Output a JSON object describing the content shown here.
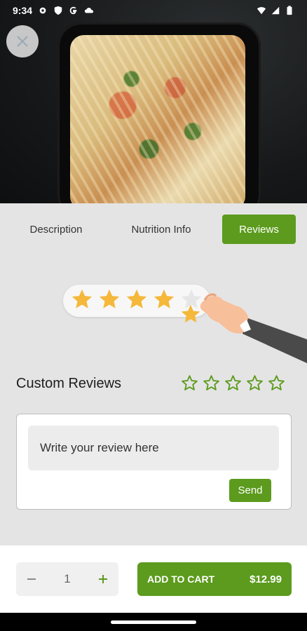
{
  "status": {
    "time": "9:34",
    "left_icons": [
      "gear-icon",
      "shield-icon",
      "google-icon",
      "cloud-icon"
    ],
    "right_icons": [
      "wifi-icon",
      "signal-icon",
      "battery-icon"
    ]
  },
  "hero": {
    "close_icon": "close-icon"
  },
  "tabs": [
    {
      "label": "Description",
      "active": false
    },
    {
      "label": "Nutrition Info",
      "active": false
    },
    {
      "label": "Reviews",
      "active": true
    }
  ],
  "reviews": {
    "title": "Custom Reviews",
    "star_rating_value": 0,
    "star_count": 5,
    "input_placeholder": "Write your review here",
    "input_value": "",
    "send_label": "Send"
  },
  "illustration": {
    "filled_stars": 4,
    "total_stars": 5
  },
  "cart": {
    "quantity": "1",
    "minus_icon": "minus-icon",
    "plus_icon": "plus-icon",
    "add_label": "ADD TO CART",
    "price": "$12.99"
  },
  "colors": {
    "accent": "#5c9b1d",
    "content_bg": "#e4e4e4",
    "star_fill": "#f5b83a"
  }
}
